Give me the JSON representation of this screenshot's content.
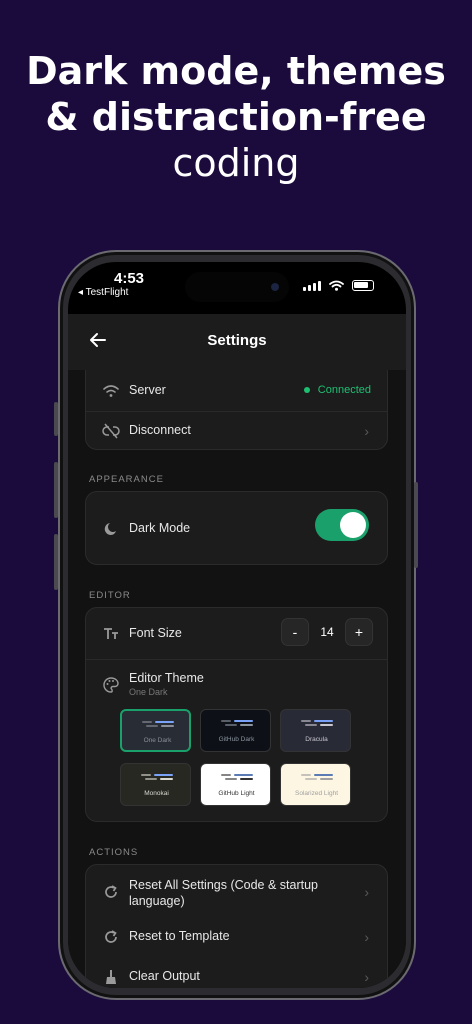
{
  "headline": {
    "line1": "Dark mode, themes",
    "line2": "& distraction-free",
    "line3": "coding"
  },
  "status_bar": {
    "time": "4:53",
    "back_app": "◂ TestFlight"
  },
  "nav": {
    "title": "Settings",
    "back_icon": "arrow-left-icon"
  },
  "connection": {
    "server_label": "Server",
    "server_status": "Connected",
    "status_color": "#1fbf72",
    "disconnect_label": "Disconnect"
  },
  "appearance": {
    "section_title": "APPEARANCE",
    "dark_mode_label": "Dark Mode",
    "dark_mode_on": true
  },
  "editor": {
    "section_title": "EDITOR",
    "font_size_label": "Font Size",
    "font_size_minus": "-",
    "font_size_value": "14",
    "font_size_plus": "+",
    "theme_label": "Editor Theme",
    "theme_selected": "One Dark",
    "themes": [
      {
        "name": "One Dark",
        "bg": "#282c34",
        "text": "#8a8f98",
        "selected": true
      },
      {
        "name": "GitHub Dark",
        "bg": "#0d1117",
        "text": "#8b949e",
        "selected": false
      },
      {
        "name": "Dracula",
        "bg": "#282a36",
        "text": "#c8c8d0",
        "selected": false
      },
      {
        "name": "Monokai",
        "bg": "#272822",
        "text": "#d8d8d0",
        "selected": false
      },
      {
        "name": "GitHub Light",
        "bg": "#ffffff",
        "text": "#333333",
        "selected": false
      },
      {
        "name": "Solarized Light",
        "bg": "#fdf6e3",
        "text": "#a0a0a0",
        "selected": false
      }
    ]
  },
  "actions": {
    "section_title": "ACTIONS",
    "reset_all_label": "Reset All Settings (Code & startup language)",
    "reset_template_label": "Reset to Template",
    "clear_output_label": "Clear Output"
  },
  "colors": {
    "background": "#1b0b3c",
    "accent_green": "#1aa06a"
  }
}
